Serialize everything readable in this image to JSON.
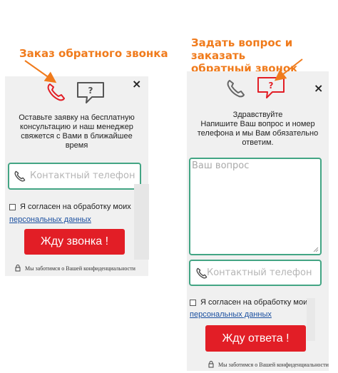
{
  "annotations": {
    "left": "Заказ обратного звонка",
    "right_line1": "Задать вопрос и заказать",
    "right_line2": "обратный звонок"
  },
  "colors": {
    "accent_orange": "#f07b1c",
    "button_red": "#e21e26",
    "field_border": "#43a584",
    "link_blue": "#1a4fa0"
  },
  "left_widget": {
    "tab_call_icon": "phone-icon",
    "tab_question_icon": "question-bubble-icon",
    "close_label": "×",
    "message": [
      "Оставьте заявку на бесплатную",
      "консультацию и наш менеджер",
      "свяжется с Вами в ближайшее",
      "время"
    ],
    "phone_placeholder": "Контактный телефон",
    "consent_text": "Я согласен на обработку моих",
    "consent_link": "персональных данных",
    "submit_label": "Жду звонка !",
    "privacy_text": "Мы заботимся о Вашей конфиденциальности"
  },
  "right_widget": {
    "close_label": "×",
    "message": [
      "Здравствуйте",
      "Напишите Ваш вопрос и номер",
      "телефона и мы Вам обязательно",
      "ответим."
    ],
    "question_placeholder": "Ваш вопрос",
    "phone_placeholder": "Контактный телефон",
    "consent_text": "Я согласен на обработку моих",
    "consent_link": "персональных данных",
    "submit_label": "Жду ответа !",
    "privacy_text": "Мы заботимся о Вашей конфиденциальности"
  }
}
